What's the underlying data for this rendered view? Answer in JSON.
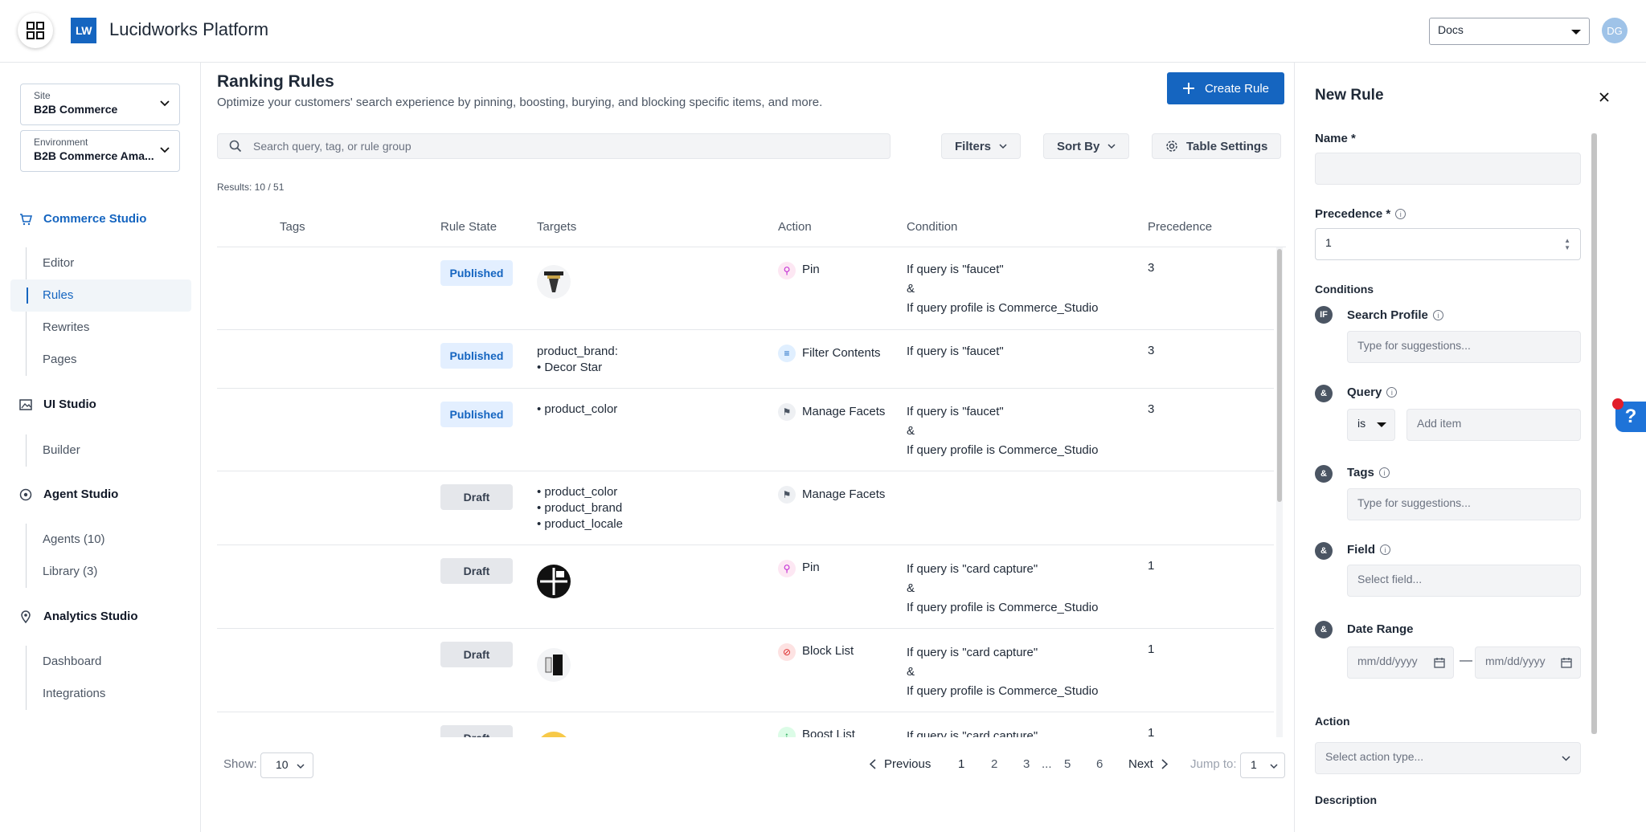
{
  "app": {
    "logo": "LW",
    "title": "Lucidworks Platform"
  },
  "header": {
    "docs_select": "Docs",
    "avatar_initials": "DG"
  },
  "sidebar": {
    "site": {
      "label": "Site",
      "value": "B2B Commerce"
    },
    "environment": {
      "label": "Environment",
      "value": "B2B Commerce Ama..."
    },
    "studios": [
      {
        "name": "Commerce Studio",
        "items": [
          "Editor",
          "Rules",
          "Rewrites",
          "Pages"
        ]
      },
      {
        "name": "UI Studio",
        "items": [
          "Builder"
        ]
      },
      {
        "name": "Agent Studio",
        "items": [
          "Agents (10)",
          "Library (3)"
        ]
      },
      {
        "name": "Analytics Studio",
        "items": [
          "Dashboard",
          "Integrations"
        ]
      }
    ]
  },
  "main": {
    "title": "Ranking Rules",
    "subtitle": "Optimize your customers' search experience by pinning, boosting, burying, and blocking specific items, and more.",
    "create_button": "Create Rule",
    "search_placeholder": "Search query, tag, or rule group",
    "filters_label": "Filters",
    "sort_label": "Sort By",
    "table_settings_label": "Table Settings",
    "results": "Results: 10 / 51",
    "columns": [
      "Tags",
      "Rule State",
      "Targets",
      "Action",
      "Condition",
      "Precedence"
    ],
    "rows": [
      {
        "state": "Published",
        "targets": [
          "(product image)"
        ],
        "action": "Pin",
        "condition": [
          "If query is \"faucet\"",
          "&",
          "If query profile is Commerce_Studio"
        ],
        "precedence": "3"
      },
      {
        "state": "Published",
        "targets": [
          "product_brand:",
          "• Decor Star"
        ],
        "action": "Filter Contents",
        "condition": [
          "If query is \"faucet\""
        ],
        "precedence": "3"
      },
      {
        "state": "Published",
        "targets": [
          "• product_color"
        ],
        "action": "Manage Facets",
        "condition": [
          "If query is \"faucet\"",
          "&",
          "If query profile is Commerce_Studio"
        ],
        "precedence": "3"
      },
      {
        "state": "Draft",
        "targets": [
          "• product_color",
          "• product_brand",
          "• product_locale"
        ],
        "action": "Manage Facets",
        "condition": [],
        "precedence": ""
      },
      {
        "state": "Draft",
        "targets": [
          "(product image)"
        ],
        "action": "Pin",
        "condition": [
          "If query is \"card capture\"",
          "&",
          "If query profile is Commerce_Studio"
        ],
        "precedence": "1"
      },
      {
        "state": "Draft",
        "targets": [
          "(product image)"
        ],
        "action": "Block List",
        "condition": [
          "If query is \"card capture\"",
          "&",
          "If query profile is Commerce_Studio"
        ],
        "precedence": "1"
      },
      {
        "state": "Draft",
        "targets": [
          "(product image)"
        ],
        "action": "Boost List",
        "condition": [
          "If query is \"card capture\""
        ],
        "precedence": "1"
      }
    ],
    "pagination": {
      "show_label": "Show:",
      "show_value": "10",
      "previous": "Previous",
      "next": "Next",
      "pages": [
        "1",
        "2",
        "3",
        "...",
        "5",
        "6"
      ],
      "jump_label": "Jump to:",
      "jump_value": "1"
    }
  },
  "panel": {
    "title": "New Rule",
    "name_label": "Name *",
    "precedence_label": "Precedence *",
    "precedence_value": "1",
    "conditions_label": "Conditions",
    "search_profile_label": "Search Profile",
    "search_profile_placeholder": "Type for suggestions...",
    "query_label": "Query",
    "query_operator": "is",
    "query_placeholder": "Add item",
    "tags_label": "Tags",
    "tags_placeholder": "Type for suggestions...",
    "field_label": "Field",
    "field_placeholder": "Select field...",
    "date_range_label": "Date Range",
    "date_placeholder": "mm/dd/yyyy",
    "action_label": "Action",
    "action_placeholder": "Select action type...",
    "description_label": "Description",
    "if_badge": "IF",
    "and_badge": "&"
  },
  "help_label": "?"
}
